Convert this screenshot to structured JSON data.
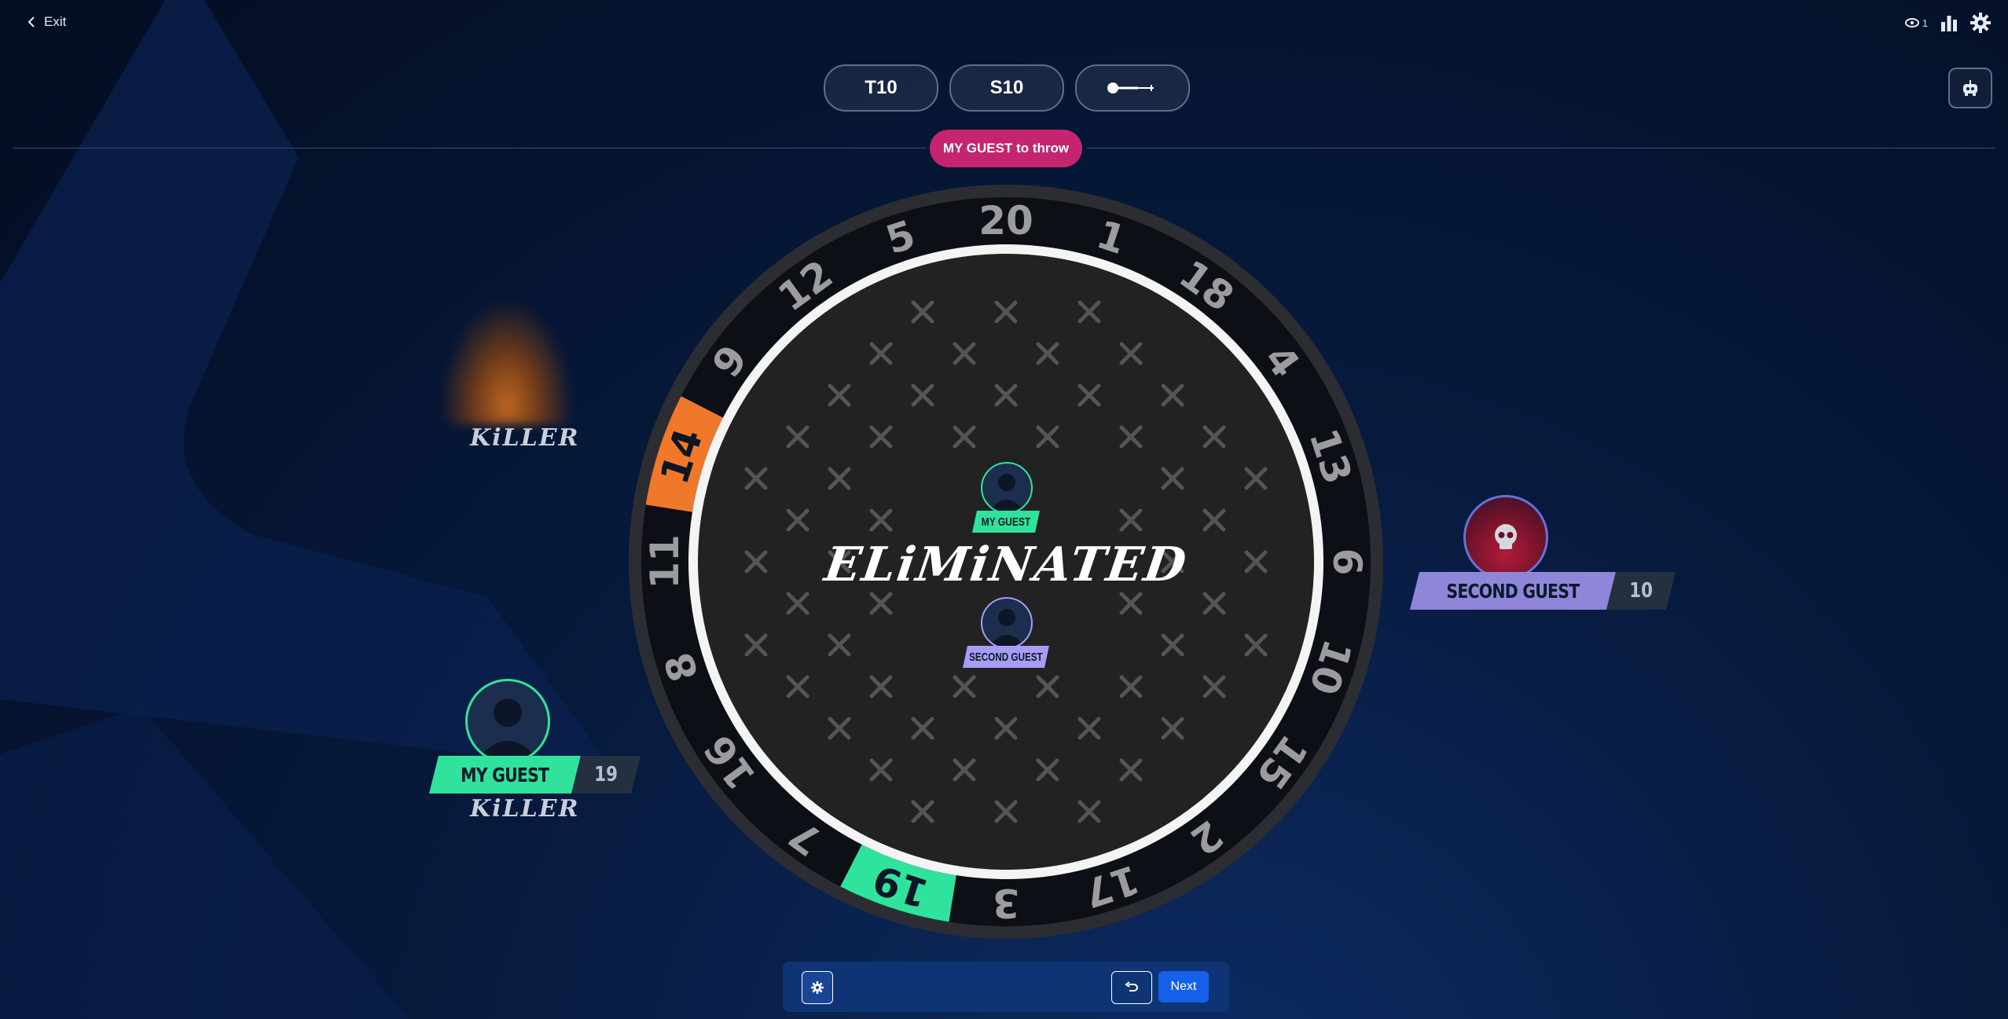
{
  "header": {
    "exit_label": "Exit",
    "viewer_count": "1",
    "icons": {
      "exit": "chevron-left-icon",
      "viewers": "eye-icon",
      "stats": "bar-chart-icon",
      "settings": "gear-icon",
      "bot": "robot-icon"
    }
  },
  "targets": [
    {
      "label": "T10"
    },
    {
      "label": "S10"
    },
    {
      "label": "",
      "icon": "dart-icon"
    }
  ],
  "turn": {
    "label": "MY GUEST to throw",
    "color": "#c4256e"
  },
  "board": {
    "numbers": [
      "20",
      "1",
      "18",
      "4",
      "13",
      "6",
      "10",
      "15",
      "2",
      "17",
      "3",
      "19",
      "7",
      "16",
      "8",
      "11",
      "14",
      "9",
      "12",
      "5"
    ],
    "highlighted": [
      {
        "number": "14",
        "color": "#f0782a"
      },
      {
        "number": "19",
        "color": "#2fe39c"
      }
    ],
    "center_status": "ELiMiNATED",
    "center_players": [
      {
        "name": "MY GUEST",
        "color": "#2fe39c"
      },
      {
        "name": "SECOND GUEST",
        "color": "#a89cf5"
      }
    ],
    "colors": {
      "surface": "#222222",
      "ring": "#0c0f15",
      "rim": "#2b2d32",
      "mark": "#555555"
    }
  },
  "players": {
    "left_top": {
      "status": "KiLLER"
    },
    "my_guest": {
      "name": "MY GUEST",
      "score": "19",
      "status": "KiLLER",
      "color": "#2fe39c"
    },
    "second_guest": {
      "name": "SECOND GUEST",
      "score": "10",
      "color": "#8f86d9"
    }
  },
  "footer": {
    "settings_icon": "gear-icon",
    "undo_icon": "undo-icon",
    "next_label": "Next"
  }
}
